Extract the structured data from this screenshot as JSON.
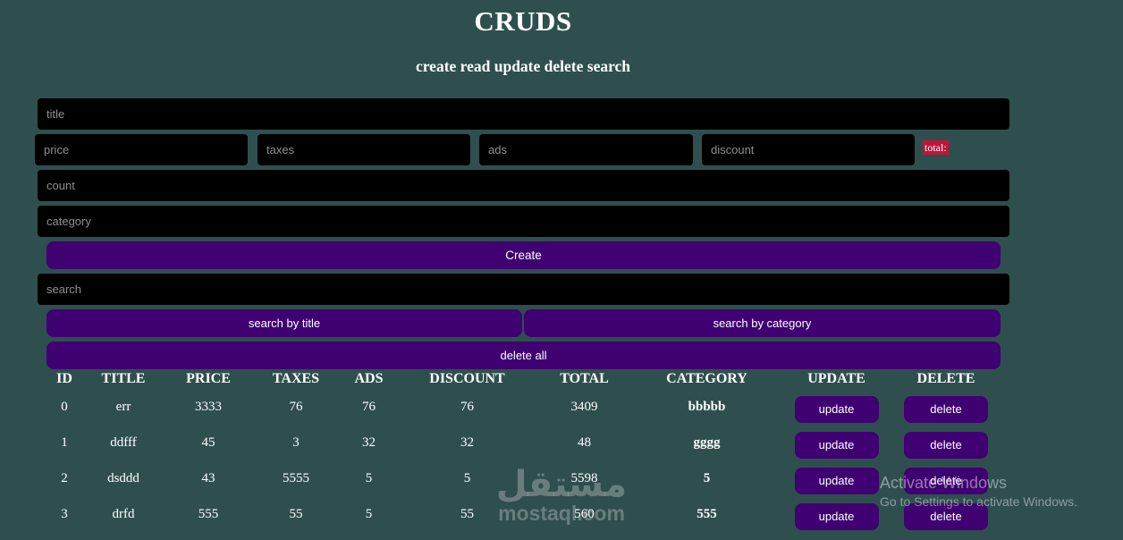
{
  "header": {
    "title": "CRUDS",
    "subtitle": "create read update delete search"
  },
  "form": {
    "title_placeholder": "title",
    "price_placeholder": "price",
    "taxes_placeholder": "taxes",
    "ads_placeholder": "ads",
    "discount_placeholder": "discount",
    "total_label": "total:",
    "count_placeholder": "count",
    "category_placeholder": "category",
    "create_label": "Create",
    "search_placeholder": "search",
    "search_by_title_label": "search by title",
    "search_by_category_label": "search by category",
    "delete_all_label": "delete all"
  },
  "colors": {
    "background": "#2f4f4f",
    "input_background": "#000000",
    "button": "#3f0071",
    "total_badge": "#c0143c"
  },
  "table": {
    "headers": [
      "ID",
      "TITLE",
      "PRICE",
      "TAXES",
      "ADS",
      "DISCOUNT",
      "TOTAL",
      "CATEGORY",
      "UPDATE",
      "DELETE"
    ],
    "update_label": "update",
    "delete_label": "delete",
    "rows": [
      {
        "id": "0",
        "title": "err",
        "price": "3333",
        "taxes": "76",
        "ads": "76",
        "discount": "76",
        "total": "3409",
        "category": "bbbbb"
      },
      {
        "id": "1",
        "title": "ddfff",
        "price": "45",
        "taxes": "3",
        "ads": "32",
        "discount": "32",
        "total": "48",
        "category": "gggg"
      },
      {
        "id": "2",
        "title": "dsddd",
        "price": "43",
        "taxes": "5555",
        "ads": "5",
        "discount": "5",
        "total": "5598",
        "category": "5"
      },
      {
        "id": "3",
        "title": "drfd",
        "price": "555",
        "taxes": "55",
        "ads": "5",
        "discount": "55",
        "total": "560",
        "category": "555"
      }
    ]
  },
  "watermark": {
    "arabic": "مستقل",
    "latin": "mostaql.com"
  },
  "os_notice": {
    "line1": "Activate Windows",
    "line2": "Go to Settings to activate Windows."
  }
}
